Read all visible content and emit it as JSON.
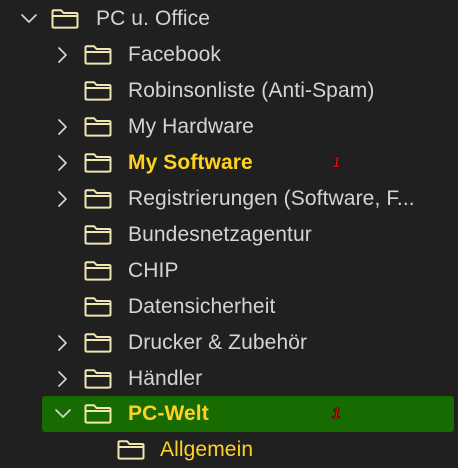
{
  "tree": {
    "items": [
      {
        "label": "PC u. Office",
        "chevron": "expanded",
        "icon": "folder-icon",
        "color": "#d4d4d4",
        "bold": false,
        "badge": null,
        "selected": false
      },
      {
        "label": "Facebook",
        "chevron": "collapsed",
        "icon": "folder-icon",
        "color": "#d4d4d4",
        "bold": false,
        "badge": null,
        "selected": false
      },
      {
        "label": "Robinsonliste (Anti-Spam)",
        "chevron": null,
        "icon": "folder-icon",
        "color": "#d4d4d4",
        "bold": false,
        "badge": null,
        "selected": false
      },
      {
        "label": "My Hardware",
        "chevron": "collapsed",
        "icon": "folder-icon",
        "color": "#d4d4d4",
        "bold": false,
        "badge": null,
        "selected": false
      },
      {
        "label": "My Software",
        "chevron": "collapsed",
        "icon": "folder-icon",
        "color": "#ffd21f",
        "bold": true,
        "badge": "1",
        "selected": false
      },
      {
        "label": "Registrierungen (Software, F...",
        "chevron": "collapsed",
        "icon": "folder-icon",
        "color": "#d4d4d4",
        "bold": false,
        "badge": null,
        "selected": false
      },
      {
        "label": "Bundesnetzagentur",
        "chevron": null,
        "icon": "folder-icon",
        "color": "#d4d4d4",
        "bold": false,
        "badge": null,
        "selected": false
      },
      {
        "label": "CHIP",
        "chevron": null,
        "icon": "folder-icon",
        "color": "#d4d4d4",
        "bold": false,
        "badge": null,
        "selected": false
      },
      {
        "label": "Datensicherheit",
        "chevron": null,
        "icon": "folder-icon",
        "color": "#d4d4d4",
        "bold": false,
        "badge": null,
        "selected": false
      },
      {
        "label": "Drucker & Zubehör",
        "chevron": "collapsed",
        "icon": "folder-icon",
        "color": "#d4d4d4",
        "bold": false,
        "badge": null,
        "selected": false
      },
      {
        "label": "Händler",
        "chevron": "collapsed",
        "icon": "folder-icon",
        "color": "#d4d4d4",
        "bold": false,
        "badge": null,
        "selected": false
      },
      {
        "label": "PC-Welt",
        "chevron": "expanded",
        "icon": "folder-icon",
        "color": "#ffd21f",
        "bold": true,
        "badge": "1",
        "selected": true
      },
      {
        "label": "Allgemein",
        "chevron": null,
        "icon": "folder-icon",
        "color": "#ffd21f",
        "bold": false,
        "badge": null,
        "selected": false
      }
    ]
  },
  "colors": {
    "background": "#202020",
    "text": "#d4d4d4",
    "highlight_text": "#ffd21f",
    "selection": "#186b00",
    "badge": "#e81010",
    "folder_stroke": "#f1e6b0"
  }
}
